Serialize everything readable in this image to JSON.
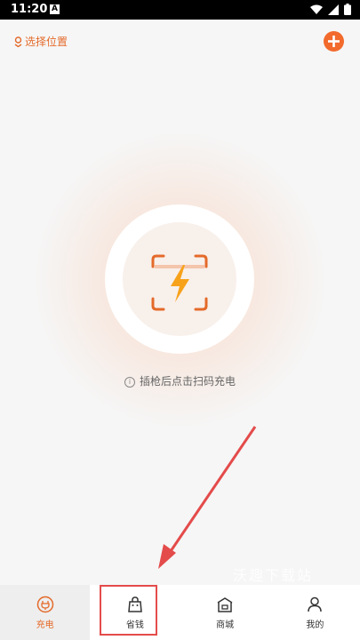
{
  "status_bar": {
    "time": "11:20",
    "notification_icon_letter": "A"
  },
  "header": {
    "location_label": "选择位置",
    "accent_color": "#f26a2c"
  },
  "scan": {
    "hint_text": "插枪后点击扫码充电"
  },
  "watermark": "沃趣下载站",
  "bottom_nav": {
    "items": [
      {
        "label": "充电",
        "icon": "charge-plug-icon",
        "active": true
      },
      {
        "label": "省钱",
        "icon": "shopping-bag-icon",
        "active": false
      },
      {
        "label": "商城",
        "icon": "store-icon",
        "active": false
      },
      {
        "label": "我的",
        "icon": "user-icon",
        "active": false
      }
    ]
  }
}
